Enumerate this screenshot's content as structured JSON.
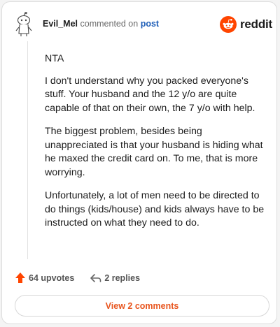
{
  "comment": {
    "username": "Evil_Mel",
    "action_text": "commented on",
    "target_text": "post",
    "paragraphs": [
      "NTA",
      "I don't understand why you packed everyone's stuff. Your husband and the 12 y/o are quite capable of that on their own, the 7 y/o with help.",
      "The biggest problem, besides being unappreciated is that your husband is hiding what he maxed the credit card on. To me, that is more worrying.",
      "Unfortunately, a lot of men need to be directed to do things (kids/house) and kids always have to be instructed on what they need to do."
    ]
  },
  "brand": {
    "name": "reddit",
    "color": "#ff4500"
  },
  "stats": {
    "upvotes_label": "64 upvotes",
    "replies_label": "2 replies"
  },
  "cta": {
    "view_comments_label": "View 2 comments"
  },
  "icons": {
    "avatar": "snoo-avatar-icon",
    "upvote": "upvote-arrow-icon",
    "reply": "reply-arrow-icon",
    "logo": "reddit-logo-icon"
  }
}
